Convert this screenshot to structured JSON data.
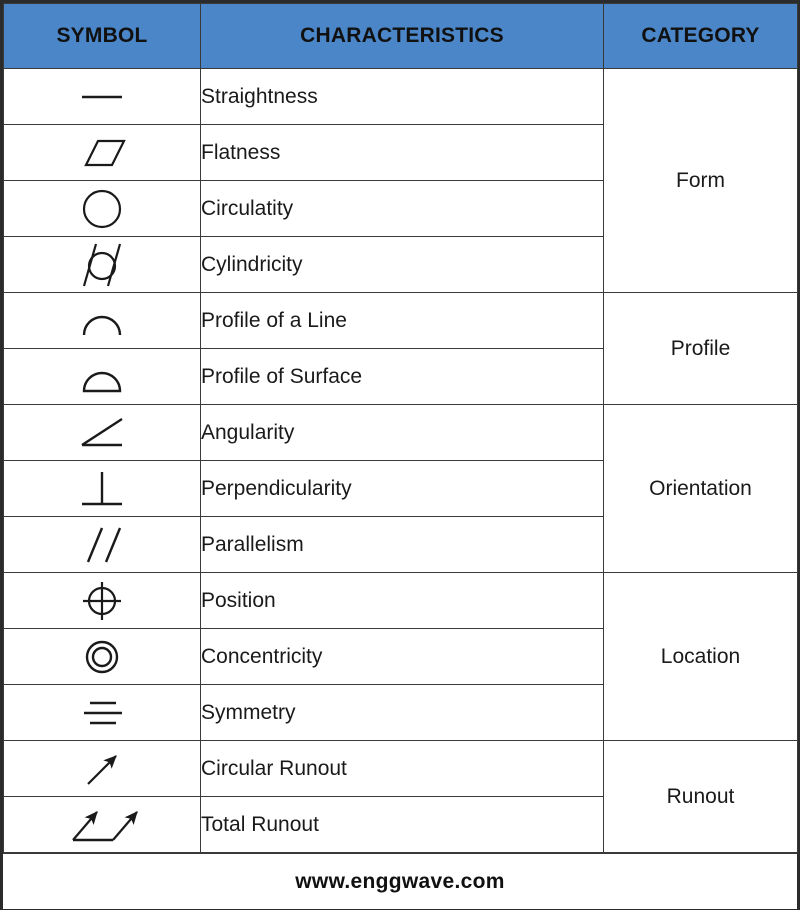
{
  "table": {
    "headers": {
      "symbol": "SYMBOL",
      "characteristics": "CHARACTERISTICS",
      "category": "CATEGORY"
    },
    "header_bg": "#4a86c8",
    "border_color": "#2b2b2b",
    "rows": [
      {
        "symbol_icon": "straightness-symbol",
        "characteristic": "Straightness"
      },
      {
        "symbol_icon": "flatness-symbol",
        "characteristic": "Flatness"
      },
      {
        "symbol_icon": "circularity-symbol",
        "characteristic": "Circulatity"
      },
      {
        "symbol_icon": "cylindricity-symbol",
        "characteristic": "Cylindricity"
      },
      {
        "symbol_icon": "profile-of-a-line-symbol",
        "characteristic": "Profile of a Line"
      },
      {
        "symbol_icon": "profile-of-surface-symbol",
        "characteristic": "Profile of Surface"
      },
      {
        "symbol_icon": "angularity-symbol",
        "characteristic": "Angularity"
      },
      {
        "symbol_icon": "perpendicularity-symbol",
        "characteristic": "Perpendicularity"
      },
      {
        "symbol_icon": "parallelism-symbol",
        "characteristic": "Parallelism"
      },
      {
        "symbol_icon": "position-symbol",
        "characteristic": "Position"
      },
      {
        "symbol_icon": "concentricity-symbol",
        "characteristic": "Concentricity"
      },
      {
        "symbol_icon": "symmetry-symbol",
        "characteristic": "Symmetry"
      },
      {
        "symbol_icon": "circular-runout-symbol",
        "characteristic": "Circular Runout"
      },
      {
        "symbol_icon": "total-runout-symbol",
        "characteristic": "Total Runout"
      }
    ],
    "categories": [
      {
        "label": "Form",
        "span": 4
      },
      {
        "label": "Profile",
        "span": 2
      },
      {
        "label": "Orientation",
        "span": 3
      },
      {
        "label": "Location",
        "span": 3
      },
      {
        "label": "Runout",
        "span": 2
      }
    ]
  },
  "footer": {
    "text": "www.enggwave.com"
  }
}
